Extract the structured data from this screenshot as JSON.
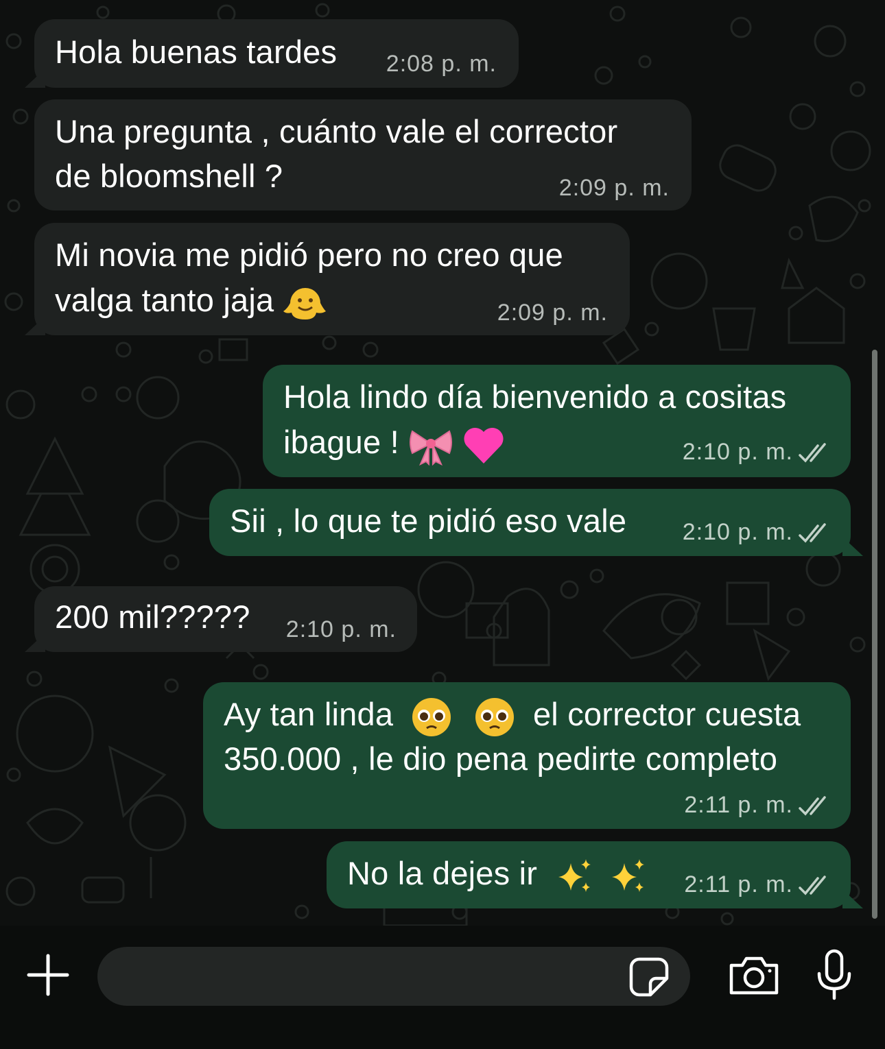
{
  "messages": [
    {
      "direction": "in",
      "lines": [
        "Hola buenas tardes"
      ],
      "time": "2:08 p. m."
    },
    {
      "direction": "in",
      "lines": [
        "Una pregunta , cuánto vale el corrector",
        "de bloomshell ?"
      ],
      "time": "2:09 p. m."
    },
    {
      "direction": "in",
      "lines": [
        "Mi novia me pidió pero no creo que",
        "valga tanto jaja"
      ],
      "emoji": "melting-face",
      "time": "2:09 p. m."
    },
    {
      "direction": "out",
      "lines": [
        "Hola lindo día bienvenido a cositas",
        "ibague !"
      ],
      "emoji": "ribbon, pink-heart",
      "time": "2:10 p. m.",
      "status": "read"
    },
    {
      "direction": "out",
      "lines": [
        "Sii , lo que te pidió eso vale"
      ],
      "time": "2:10 p. m.",
      "status": "read"
    },
    {
      "direction": "in",
      "lines": [
        "200 mil?????"
      ],
      "time": "2:10 p. m."
    },
    {
      "direction": "out",
      "lines": [
        "Ay tan linda",
        "el corrector cuesta",
        "350.000 , le dio pena pedirte completo"
      ],
      "emoji": "pleading-face, pleading-face",
      "time": "2:11 p. m.",
      "status": "read"
    },
    {
      "direction": "out",
      "lines": [
        "No la dejes ir"
      ],
      "emoji": "sparkles, sparkles",
      "time": "2:11 p. m.",
      "status": "read"
    }
  ],
  "composer": {
    "placeholder": "",
    "icons": {
      "plus": "plus-icon",
      "sticker": "sticker-icon",
      "camera": "camera-icon",
      "mic": "microphone-icon"
    }
  },
  "colors": {
    "incoming_bubble": "#1f2221",
    "outgoing_bubble": "#1b4a33",
    "background": "#0e100f",
    "timestamp": "#b7bcb9"
  }
}
